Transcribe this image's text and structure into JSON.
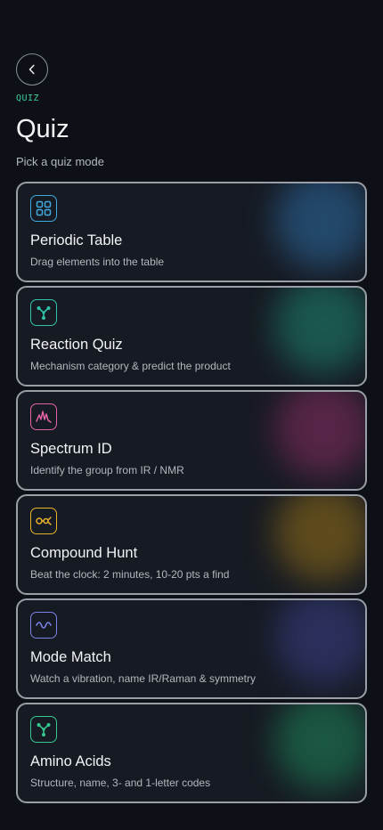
{
  "header": {
    "eyebrow": "QUIZ",
    "title": "Quiz",
    "subtitle": "Pick a quiz mode"
  },
  "cards": [
    {
      "title": "Periodic Table",
      "description": "Drag elements into the table",
      "icon": "grid-icon",
      "color": "#3fa9e0"
    },
    {
      "title": "Reaction Quiz",
      "description": "Mechanism category & predict the product",
      "icon": "molecule-icon",
      "color": "#2fc4a9"
    },
    {
      "title": "Spectrum ID",
      "description": "Identify the group from IR / NMR",
      "icon": "spectrum-icon",
      "color": "#e462a8"
    },
    {
      "title": "Compound Hunt",
      "description": "Beat the clock: 2 minutes, 10-20 pts a find",
      "icon": "hunt-icon",
      "color": "#e7b32c"
    },
    {
      "title": "Mode Match",
      "description": "Watch a vibration, name IR/Raman & symmetry",
      "icon": "wave-icon",
      "color": "#7c83e8"
    },
    {
      "title": "Amino Acids",
      "description": "Structure, name, 3- and 1-letter codes",
      "icon": "molecule-icon",
      "color": "#33c98f"
    }
  ]
}
